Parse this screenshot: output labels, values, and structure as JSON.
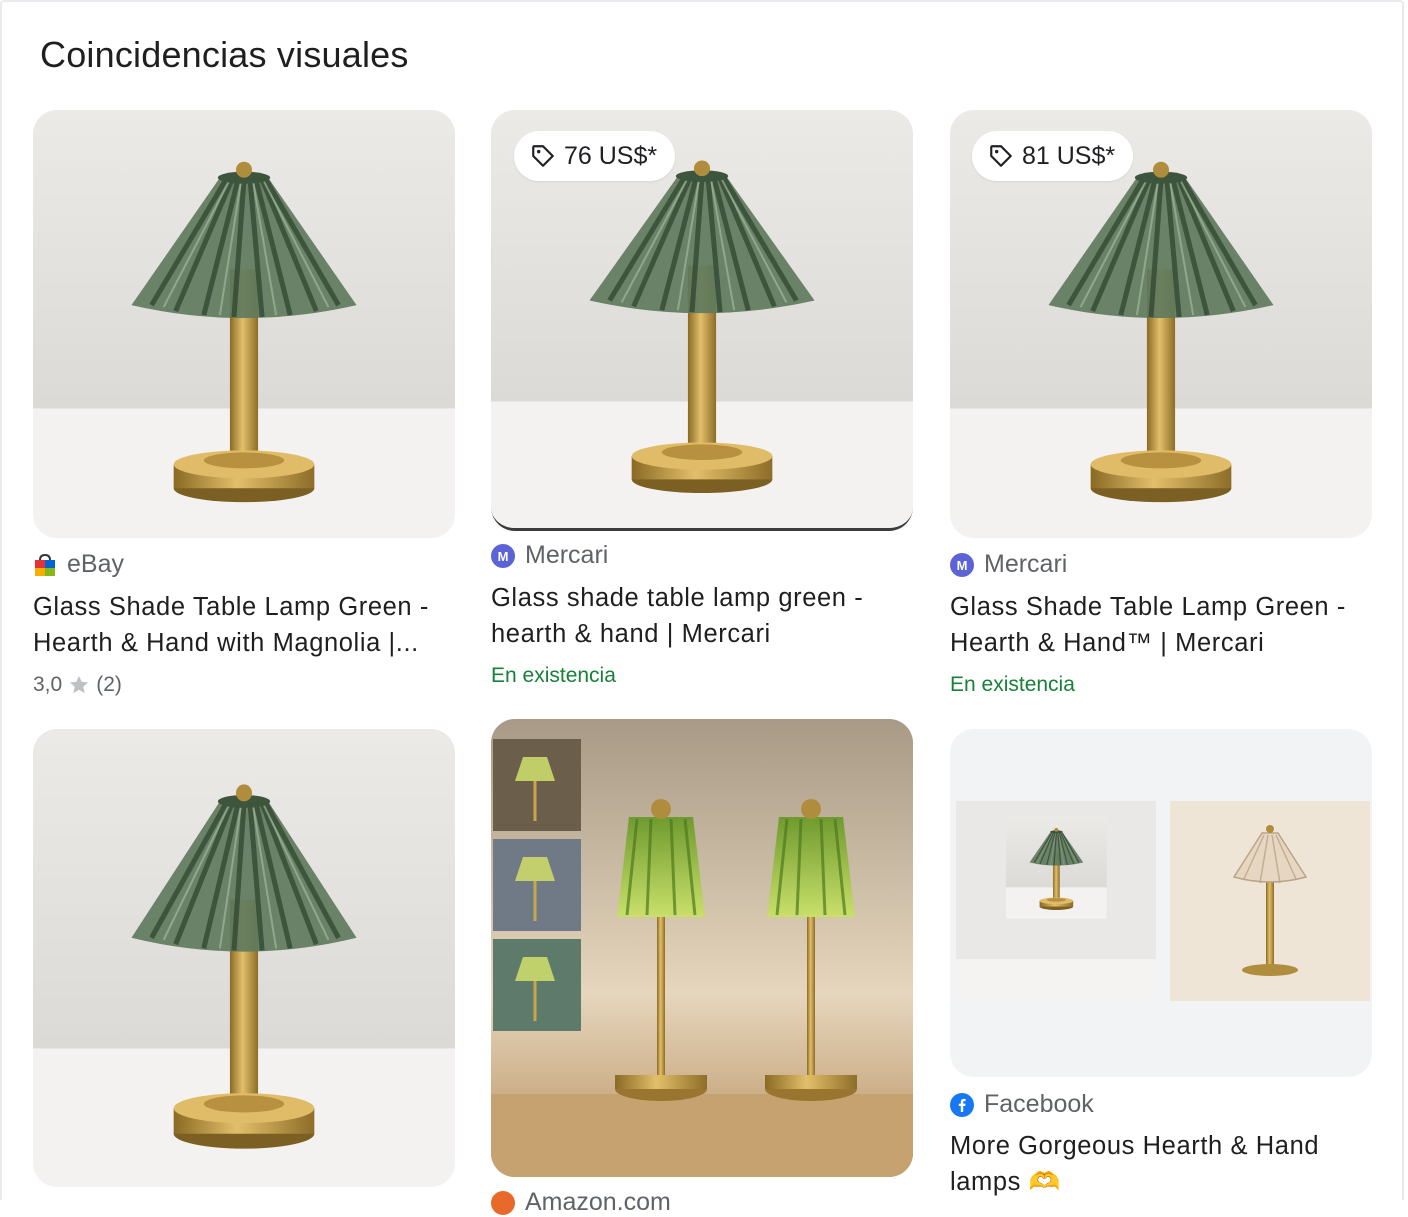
{
  "section_title": "Coincidencias visuales",
  "results": [
    {
      "source": "eBay",
      "title_line1": "Glass Shade Table Lamp Green -",
      "title_line2": "Hearth & Hand with Magnolia |...",
      "rating_value": "3,0",
      "rating_count": "(2)"
    },
    {
      "source": "Mercari",
      "price": "76 US$*",
      "title_line1": "Glass shade table lamp green -",
      "title_line2": "hearth & hand | Mercari",
      "availability": "En existencia"
    },
    {
      "source": "Mercari",
      "price": "81 US$*",
      "title_line1": "Glass Shade Table Lamp Green -",
      "title_line2": "Hearth & Hand™ | Mercari",
      "availability": "En existencia"
    },
    {
      "source": null
    },
    {
      "source": "Amazon.com"
    },
    {
      "source": "Facebook",
      "title_line1": "More Gorgeous Hearth & Hand",
      "title_line2": "lamps 🫶"
    }
  ],
  "icons": {
    "price_tag": "tag-icon",
    "rating_star": "star-icon",
    "ebay": "ebay-favicon-icon",
    "mercari": "mercari-favicon-icon",
    "amazon": "amazon-favicon-icon",
    "facebook": "facebook-favicon-icon"
  },
  "colors": {
    "in_stock": "#188038",
    "source_text": "#5f6368",
    "mercari": "#5b63d6",
    "facebook": "#1877f2",
    "amazon": "#e8692a",
    "lamp_shade": "#4f6b4c",
    "lamp_brass": "#c9a24a"
  }
}
